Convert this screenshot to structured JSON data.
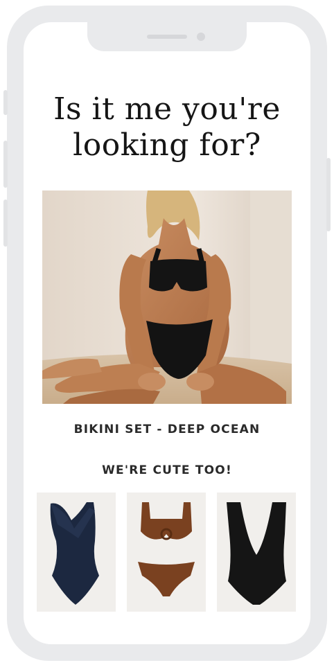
{
  "headline": {
    "line1": "Is it me you're",
    "line2": "looking for?"
  },
  "hero": {
    "alt_icon": "bikini-model-photo"
  },
  "product": {
    "name": "BIKINI SET - DEEP OCEAN"
  },
  "section": {
    "title": "WE'RE CUTE TOO!"
  },
  "thumbnails": [
    {
      "icon": "navy-ruffle-swimsuit",
      "color": "#1c2840"
    },
    {
      "icon": "brown-ring-bikini",
      "color": "#7a4120"
    },
    {
      "icon": "black-plunge-swimsuit",
      "color": "#151515"
    }
  ],
  "colors": {
    "phone_frame": "#e9eaec",
    "text": "#2a2a2a",
    "background": "#ffffff"
  }
}
